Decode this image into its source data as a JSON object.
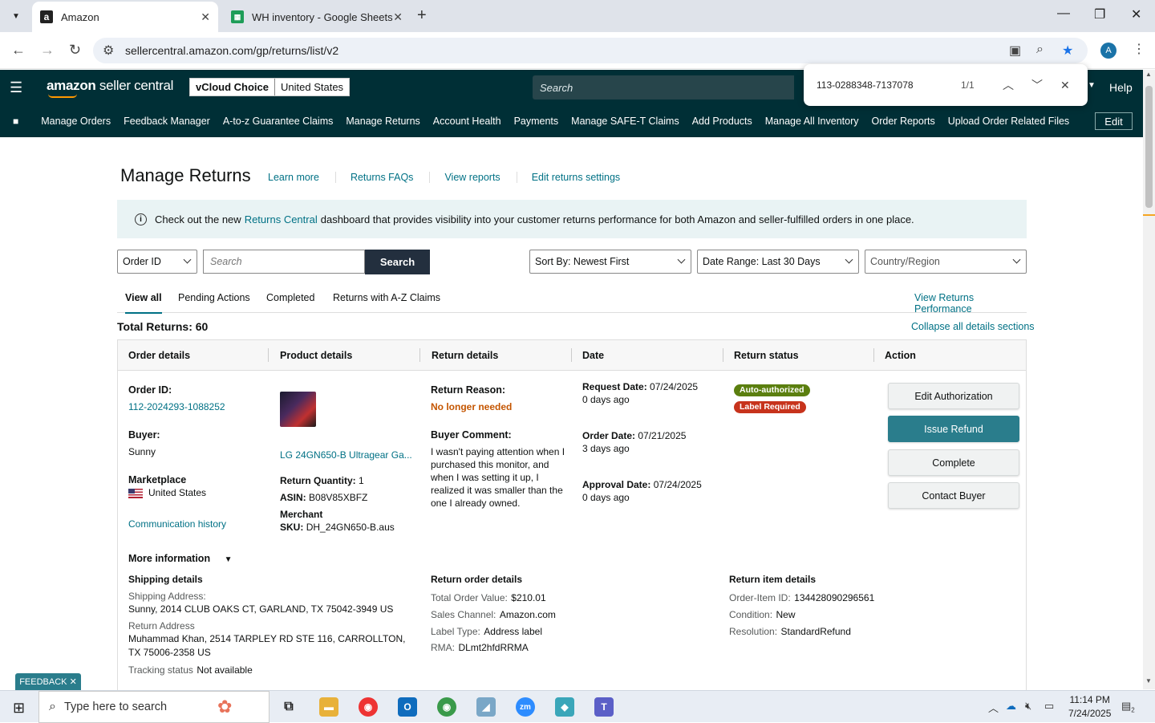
{
  "browser": {
    "tabs": [
      {
        "title": "Amazon",
        "favicon": "a"
      },
      {
        "title": "WH inventory - Google Sheets",
        "favicon": "sheets"
      }
    ],
    "url": "sellercentral.amazon.com/gp/returns/list/v2",
    "profile_initial": "A"
  },
  "findbar": {
    "query": "113-0288348-7137078",
    "count": "1/1"
  },
  "amazon_header": {
    "logo_bold": "amazon",
    "logo_rest": " seller central",
    "store_name": "vCloud Choice",
    "store_region": "United States",
    "search_placeholder": "Search",
    "help": "Help",
    "nav": [
      "Manage Orders",
      "Feedback Manager",
      "A-to-z Guarantee Claims",
      "Manage Returns",
      "Account Health",
      "Payments",
      "Manage SAFE-T Claims",
      "Add Products",
      "Manage All Inventory",
      "Order Reports",
      "Upload Order Related Files"
    ],
    "edit": "Edit"
  },
  "page": {
    "title": "Manage Returns",
    "links": [
      "Learn more",
      "Returns FAQs",
      "View reports",
      "Edit returns settings"
    ],
    "banner": {
      "pre": "Check out the new",
      "link": "Returns Central",
      "post": "dashboard that provides visibility into your customer returns performance for both Amazon and seller-fulfilled orders in one place."
    },
    "filters": {
      "type": "Order ID",
      "search_placeholder": "Search",
      "search_button": "Search",
      "sort": "Sort By: Newest First",
      "date_range": "Date Range: Last 30 Days",
      "country": "Country/Region"
    },
    "subtabs": [
      "View all",
      "Pending Actions",
      "Completed",
      "Returns with A-Z Claims"
    ],
    "view_performance": "View Returns Performance",
    "total": "Total Returns: 60",
    "collapse": "Collapse all details sections",
    "columns": [
      "Order details",
      "Product details",
      "Return details",
      "Date",
      "Return status",
      "Action"
    ]
  },
  "return": {
    "order_id_label": "Order ID:",
    "order_id": "112-2024293-1088252",
    "buyer_label": "Buyer:",
    "buyer": "Sunny",
    "marketplace_label": "Marketplace",
    "marketplace": "United States",
    "comm_history": "Communication history",
    "product_name": "LG 24GN650-B Ultragear Ga...",
    "return_qty_label": "Return Quantity:",
    "return_qty": "1",
    "asin_label": "ASIN:",
    "asin": "B08V85XBFZ",
    "merchant_label": "Merchant",
    "sku_label": "SKU:",
    "sku": "DH_24GN650-B.aus",
    "reason_label": "Return Reason:",
    "reason": "No longer needed",
    "comment_label": "Buyer Comment:",
    "comment": "I wasn't paying attention when I purchased this monitor, and when I was setting it up, I realized it was smaller than the one I already owned.",
    "request_date_label": "Request Date:",
    "request_date": "07/24/2025",
    "request_ago": "0 days ago",
    "order_date_label": "Order Date:",
    "order_date": "07/21/2025",
    "order_ago": "3 days ago",
    "approval_date_label": "Approval Date:",
    "approval_date": "07/24/2025",
    "approval_ago": "0 days ago",
    "badge_auth": "Auto-authorized",
    "badge_label": "Label Required",
    "actions": [
      "Edit Authorization",
      "Issue Refund",
      "Complete",
      "Contact Buyer"
    ],
    "more_info": "More information",
    "shipping_title": "Shipping details",
    "shipping_addr_label": "Shipping Address:",
    "shipping_addr": "Sunny, 2014 CLUB OAKS CT, GARLAND, TX 75042-3949 US",
    "return_addr_label": "Return Address",
    "return_addr_1": "Muhammad Khan, 2514 TARPLEY RD STE 116, CARROLLTON,",
    "return_addr_2": "TX 75006-2358 US",
    "tracking_label": "Tracking status",
    "tracking": "Not available",
    "rod_title": "Return order details",
    "total_order_label": "Total Order Value:",
    "total_order": "$210.01",
    "channel_label": "Sales Channel:",
    "channel": "Amazon.com",
    "label_type_label": "Label Type:",
    "label_type": "Address label",
    "rma_label": "RMA:",
    "rma": "DLmt2hfdRRMA",
    "rid_title": "Return item details",
    "order_item_label": "Order-Item ID:",
    "order_item": "134428090296561",
    "condition_label": "Condition:",
    "condition": "New",
    "resolution_label": "Resolution:",
    "resolution": "StandardRefund"
  },
  "feedback": "FEEDBACK",
  "taskbar": {
    "search_placeholder": "Type here to search",
    "time": "11:14 PM",
    "date": "7/24/2025",
    "notif": "2"
  },
  "colors": {
    "teal": "#2a7d8c",
    "header": "#002f36",
    "badge_green": "#5b7f0f",
    "badge_red": "#c7331c",
    "reason": "#c45500"
  }
}
